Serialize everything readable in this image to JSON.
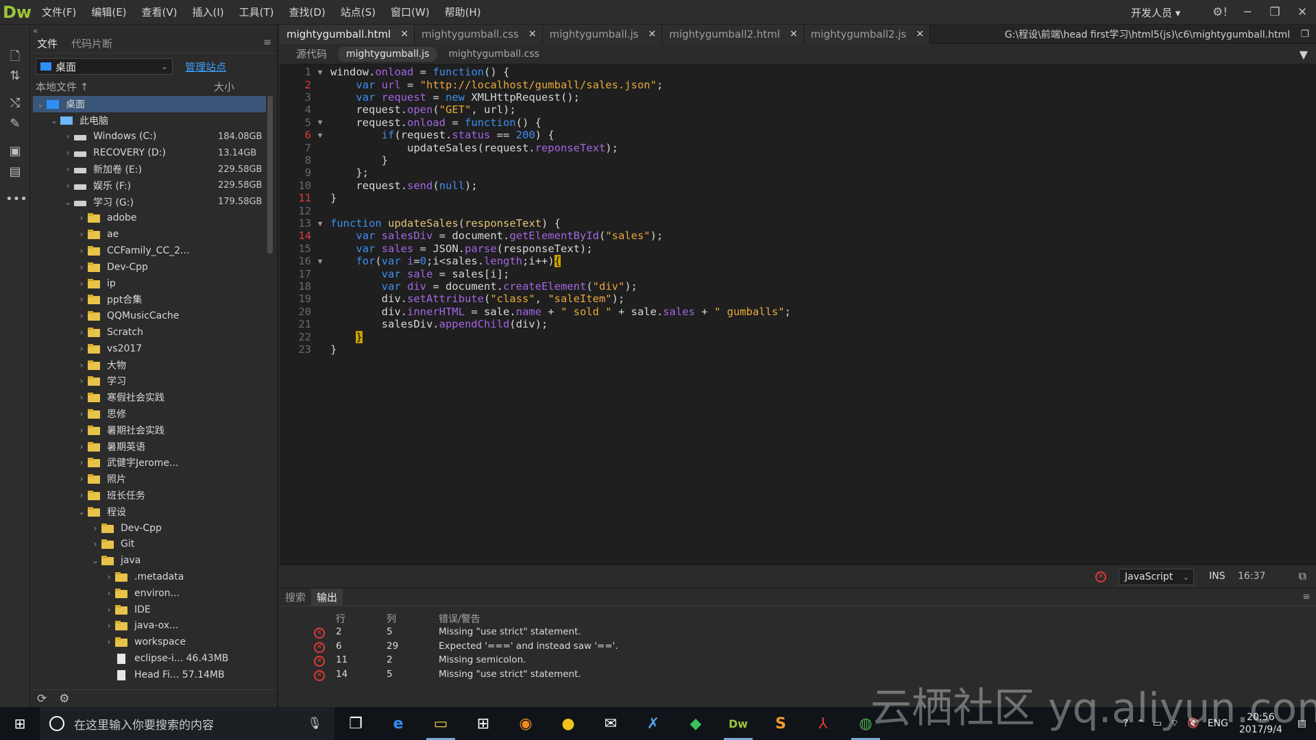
{
  "app": {
    "logo": "Dw"
  },
  "menus": [
    "文件(F)",
    "编辑(E)",
    "查看(V)",
    "插入(I)",
    "工具(T)",
    "查找(D)",
    "站点(S)",
    "窗口(W)",
    "帮助(H)"
  ],
  "workspace": "开发人员",
  "filepanel": {
    "tabs": [
      "文件",
      "代码片断"
    ],
    "site": "桌面",
    "manage_link": "管理站点",
    "col_local": "本地文件 ↑",
    "col_size": "大小",
    "tree": [
      {
        "label": "桌面",
        "level": 0,
        "arrow": "⌄",
        "icon": "desk",
        "size": "",
        "selected": true
      },
      {
        "label": "此电脑",
        "level": 1,
        "arrow": "⌄",
        "icon": "pc",
        "size": ""
      },
      {
        "label": "Windows (C:)",
        "level": 2,
        "arrow": "›",
        "icon": "drive",
        "size": "184.08GB"
      },
      {
        "label": "RECOVERY (D:)",
        "level": 2,
        "arrow": "›",
        "icon": "drive",
        "size": "13.14GB"
      },
      {
        "label": "新加卷 (E:)",
        "level": 2,
        "arrow": "›",
        "icon": "drive",
        "size": "229.58GB"
      },
      {
        "label": "娱乐 (F:)",
        "level": 2,
        "arrow": "›",
        "icon": "drive",
        "size": "229.58GB"
      },
      {
        "label": "学习 (G:)",
        "level": 2,
        "arrow": "⌄",
        "icon": "drive",
        "size": "179.58GB"
      },
      {
        "label": "adobe",
        "level": 3,
        "arrow": "›",
        "icon": "folder",
        "size": ""
      },
      {
        "label": "ae",
        "level": 3,
        "arrow": "›",
        "icon": "folder",
        "size": ""
      },
      {
        "label": "CCFamily_CC_2...",
        "level": 3,
        "arrow": "›",
        "icon": "folder",
        "size": ""
      },
      {
        "label": "Dev-Cpp",
        "level": 3,
        "arrow": "›",
        "icon": "folder",
        "size": ""
      },
      {
        "label": "ip",
        "level": 3,
        "arrow": "›",
        "icon": "folder",
        "size": ""
      },
      {
        "label": "ppt合集",
        "level": 3,
        "arrow": "›",
        "icon": "folder",
        "size": ""
      },
      {
        "label": "QQMusicCache",
        "level": 3,
        "arrow": "›",
        "icon": "folder",
        "size": ""
      },
      {
        "label": "Scratch",
        "level": 3,
        "arrow": "›",
        "icon": "folder",
        "size": ""
      },
      {
        "label": "vs2017",
        "level": 3,
        "arrow": "›",
        "icon": "folder",
        "size": ""
      },
      {
        "label": "大物",
        "level": 3,
        "arrow": "›",
        "icon": "folder",
        "size": ""
      },
      {
        "label": "学习",
        "level": 3,
        "arrow": "›",
        "icon": "folder",
        "size": ""
      },
      {
        "label": "寒假社会实践",
        "level": 3,
        "arrow": "›",
        "icon": "folder",
        "size": ""
      },
      {
        "label": "思修",
        "level": 3,
        "arrow": "›",
        "icon": "folder",
        "size": ""
      },
      {
        "label": "暑期社会实践",
        "level": 3,
        "arrow": "›",
        "icon": "folder",
        "size": ""
      },
      {
        "label": "暑期英语",
        "level": 3,
        "arrow": "›",
        "icon": "folder",
        "size": ""
      },
      {
        "label": "武健宇Jerome...",
        "level": 3,
        "arrow": "›",
        "icon": "folder",
        "size": ""
      },
      {
        "label": "照片",
        "level": 3,
        "arrow": "›",
        "icon": "folder",
        "size": ""
      },
      {
        "label": "班长任务",
        "level": 3,
        "arrow": "›",
        "icon": "folder",
        "size": ""
      },
      {
        "label": "程设",
        "level": 3,
        "arrow": "⌄",
        "icon": "folder",
        "size": ""
      },
      {
        "label": "Dev-Cpp",
        "level": 4,
        "arrow": "›",
        "icon": "folder",
        "size": ""
      },
      {
        "label": "Git",
        "level": 4,
        "arrow": "›",
        "icon": "folder",
        "size": ""
      },
      {
        "label": "java",
        "level": 4,
        "arrow": "⌄",
        "icon": "folder",
        "size": ""
      },
      {
        "label": ".metadata",
        "level": 5,
        "arrow": "›",
        "icon": "folder",
        "size": ""
      },
      {
        "label": "environ...",
        "level": 5,
        "arrow": "›",
        "icon": "folder",
        "size": ""
      },
      {
        "label": "IDE",
        "level": 5,
        "arrow": "›",
        "icon": "folder",
        "size": ""
      },
      {
        "label": "java-ox...",
        "level": 5,
        "arrow": "›",
        "icon": "folder",
        "size": ""
      },
      {
        "label": "workspace",
        "level": 5,
        "arrow": "›",
        "icon": "folder",
        "size": ""
      },
      {
        "label": "eclipse-i... 46.43MB",
        "level": 5,
        "arrow": "",
        "icon": "file",
        "size": ""
      },
      {
        "label": "Head Fi... 57.14MB",
        "level": 5,
        "arrow": "",
        "icon": "file",
        "size": ""
      }
    ]
  },
  "doc_tabs": [
    {
      "label": "mightygumball.html",
      "active": true
    },
    {
      "label": "mightygumball.css",
      "active": false
    },
    {
      "label": "mightygumball.js",
      "active": false
    },
    {
      "label": "mightygumball2.html",
      "active": false
    },
    {
      "label": "mightygumball2.js",
      "active": false
    }
  ],
  "file_path": "G:\\程设\\前端\\head first学习\\html5(js)\\c6\\mightygumball.html",
  "related_files": [
    "源代码",
    "mightygumball.js",
    "mightygumball.css"
  ],
  "active_related": 1,
  "code": {
    "error_lines": [
      2,
      6,
      11,
      14
    ],
    "fold_lines": [
      1,
      5,
      6,
      13,
      16
    ],
    "lines": [
      [
        [
          "window.",
          "t"
        ],
        [
          "onload",
          "prop"
        ],
        [
          " = ",
          "t"
        ],
        [
          "function",
          "kw"
        ],
        [
          "() {",
          "t"
        ]
      ],
      [
        [
          "    ",
          "t"
        ],
        [
          "var",
          "kw"
        ],
        [
          " ",
          "t"
        ],
        [
          "url",
          "prop"
        ],
        [
          " = ",
          "t"
        ],
        [
          "\"http://localhost/gumball/sales.json\"",
          "str"
        ],
        [
          ";",
          "t"
        ]
      ],
      [
        [
          "    ",
          "t"
        ],
        [
          "var",
          "kw"
        ],
        [
          " ",
          "t"
        ],
        [
          "request",
          "prop"
        ],
        [
          " = ",
          "t"
        ],
        [
          "new",
          "kw"
        ],
        [
          " XMLHttpRequest();",
          "t"
        ]
      ],
      [
        [
          "    request.",
          "t"
        ],
        [
          "open",
          "prop"
        ],
        [
          "(",
          "t"
        ],
        [
          "\"GET\"",
          "str"
        ],
        [
          ", url);",
          "t"
        ]
      ],
      [
        [
          "    request.",
          "t"
        ],
        [
          "onload",
          "prop"
        ],
        [
          " = ",
          "t"
        ],
        [
          "function",
          "kw"
        ],
        [
          "() {",
          "t"
        ]
      ],
      [
        [
          "        ",
          "t"
        ],
        [
          "if",
          "kw"
        ],
        [
          "(request.",
          "t"
        ],
        [
          "status",
          "prop"
        ],
        [
          " == ",
          "t"
        ],
        [
          "200",
          "num"
        ],
        [
          ") {",
          "t"
        ]
      ],
      [
        [
          "            updateSales(request.",
          "t"
        ],
        [
          "reponseText",
          "prop"
        ],
        [
          ");",
          "t"
        ]
      ],
      [
        [
          "        }",
          "t"
        ]
      ],
      [
        [
          "    };",
          "t"
        ]
      ],
      [
        [
          "    request.",
          "t"
        ],
        [
          "send",
          "prop"
        ],
        [
          "(",
          "t"
        ],
        [
          "null",
          "kw"
        ],
        [
          ");",
          "t"
        ]
      ],
      [
        [
          "}",
          "t"
        ]
      ],
      [
        [
          "",
          "t"
        ]
      ],
      [
        [
          "function",
          "kw"
        ],
        [
          " ",
          "t"
        ],
        [
          "updateSales",
          "fn"
        ],
        [
          "(",
          "t"
        ],
        [
          "responseText",
          "fn"
        ],
        [
          ") {",
          "t"
        ]
      ],
      [
        [
          "    ",
          "t"
        ],
        [
          "var",
          "kw"
        ],
        [
          " ",
          "t"
        ],
        [
          "salesDiv",
          "prop"
        ],
        [
          " = document.",
          "t"
        ],
        [
          "getElementById",
          "prop"
        ],
        [
          "(",
          "t"
        ],
        [
          "\"sales\"",
          "str"
        ],
        [
          ");",
          "t"
        ]
      ],
      [
        [
          "    ",
          "t"
        ],
        [
          "var",
          "kw"
        ],
        [
          " ",
          "t"
        ],
        [
          "sales",
          "prop"
        ],
        [
          " = JSON.",
          "t"
        ],
        [
          "parse",
          "prop"
        ],
        [
          "(responseText);",
          "t"
        ]
      ],
      [
        [
          "    ",
          "t"
        ],
        [
          "for",
          "kw"
        ],
        [
          "(",
          "t"
        ],
        [
          "var",
          "kw"
        ],
        [
          " ",
          "t"
        ],
        [
          "i",
          "prop"
        ],
        [
          "=",
          "t"
        ],
        [
          "0",
          "num"
        ],
        [
          ";i<sales.",
          "t"
        ],
        [
          "length",
          "prop"
        ],
        [
          ";i++)",
          "t"
        ],
        [
          "{",
          "hl"
        ]
      ],
      [
        [
          "        ",
          "t"
        ],
        [
          "var",
          "kw"
        ],
        [
          " ",
          "t"
        ],
        [
          "sale",
          "prop"
        ],
        [
          " = sales[i];",
          "t"
        ]
      ],
      [
        [
          "        ",
          "t"
        ],
        [
          "var",
          "kw"
        ],
        [
          " ",
          "t"
        ],
        [
          "div",
          "prop"
        ],
        [
          " = document.",
          "t"
        ],
        [
          "createElement",
          "prop"
        ],
        [
          "(",
          "t"
        ],
        [
          "\"div\"",
          "str"
        ],
        [
          ");",
          "t"
        ]
      ],
      [
        [
          "        div.",
          "t"
        ],
        [
          "setAttribute",
          "prop"
        ],
        [
          "(",
          "t"
        ],
        [
          "\"class\"",
          "str"
        ],
        [
          ", ",
          "t"
        ],
        [
          "\"saleItem\"",
          "str"
        ],
        [
          ");",
          "t"
        ]
      ],
      [
        [
          "        div.",
          "t"
        ],
        [
          "innerHTML",
          "prop"
        ],
        [
          " = sale.",
          "t"
        ],
        [
          "name",
          "prop"
        ],
        [
          " + ",
          "t"
        ],
        [
          "\" sold \"",
          "str"
        ],
        [
          " + sale.",
          "t"
        ],
        [
          "sales",
          "prop"
        ],
        [
          " + ",
          "t"
        ],
        [
          "\" gumballs\"",
          "str"
        ],
        [
          ";",
          "t"
        ]
      ],
      [
        [
          "        salesDiv.",
          "t"
        ],
        [
          "appendChild",
          "prop"
        ],
        [
          "(div);",
          "t"
        ]
      ],
      [
        [
          "    ",
          "t"
        ],
        [
          "}",
          "hl"
        ]
      ],
      [
        [
          "}",
          "t"
        ]
      ]
    ]
  },
  "status": {
    "language": "JavaScript",
    "mode": "INS",
    "position": "16:37"
  },
  "output": {
    "tabs": [
      "搜索",
      "输出"
    ],
    "active_tab": 1,
    "headers": {
      "line": "行",
      "col": "列",
      "msg": "错误/警告"
    },
    "rows": [
      {
        "line": "2",
        "col": "5",
        "msg": "Missing \"use strict\" statement."
      },
      {
        "line": "6",
        "col": "29",
        "msg": "Expected '===' and instead saw '=='."
      },
      {
        "line": "11",
        "col": "2",
        "msg": "Missing semicolon."
      },
      {
        "line": "14",
        "col": "5",
        "msg": "Missing \"use strict\" statement."
      }
    ]
  },
  "taskbar": {
    "search_placeholder": "在这里输入你要搜索的内容",
    "lang": "ENG",
    "time": "20:56",
    "date": "2017/9/4"
  },
  "watermark": "云栖社区 yq.aliyun.com"
}
